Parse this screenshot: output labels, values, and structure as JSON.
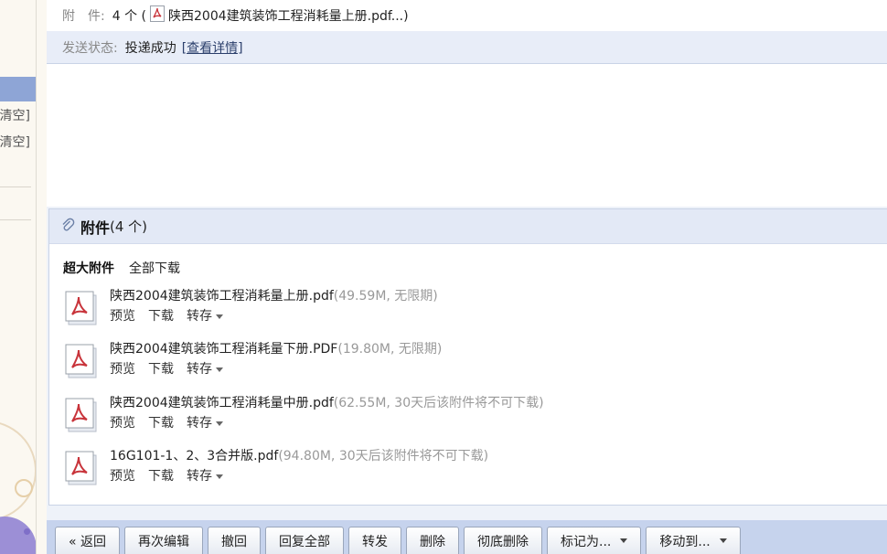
{
  "sidebar": {
    "clear_labels": [
      "清空]",
      "清空]"
    ]
  },
  "header": {
    "attach_label": "附　件:",
    "attach_value": "4 个 (",
    "attach_first_file": "陕西2004建筑装饰工程消耗量上册.pdf...)",
    "status_label": "发送状态:",
    "status_value": "投递成功",
    "status_link": "[查看详情]"
  },
  "attachments": {
    "title": "附件",
    "count": "(4 个)",
    "super_label": "超大附件",
    "download_all": "全部下载",
    "files": [
      {
        "name": "陕西2004建筑装饰工程消耗量上册.pdf",
        "meta": "(49.59M, 无限期)"
      },
      {
        "name": "陕西2004建筑装饰工程消耗量下册.PDF",
        "meta": "(19.80M, 无限期)"
      },
      {
        "name": "陕西2004建筑装饰工程消耗量中册.pdf",
        "meta": "(62.55M, 30天后该附件将不可下载)"
      },
      {
        "name": "16G101-1、2、3合并版.pdf",
        "meta": "(94.80M, 30天后该附件将不可下载)"
      }
    ],
    "actions": {
      "preview": "预览",
      "download": "下载",
      "save": "转存"
    }
  },
  "toolbar": {
    "back": "« 返回",
    "edit_again": "再次编辑",
    "recall": "撤回",
    "reply_all": "回复全部",
    "forward": "转发",
    "delete": "删除",
    "delete_permanent": "彻底删除",
    "mark_as": "标记为...",
    "move_to": "移动到..."
  },
  "colors": {
    "pdf_red": "#c8333a",
    "toolbar_bg": "#c6d3ed",
    "header_bg": "#e3e9f6"
  }
}
